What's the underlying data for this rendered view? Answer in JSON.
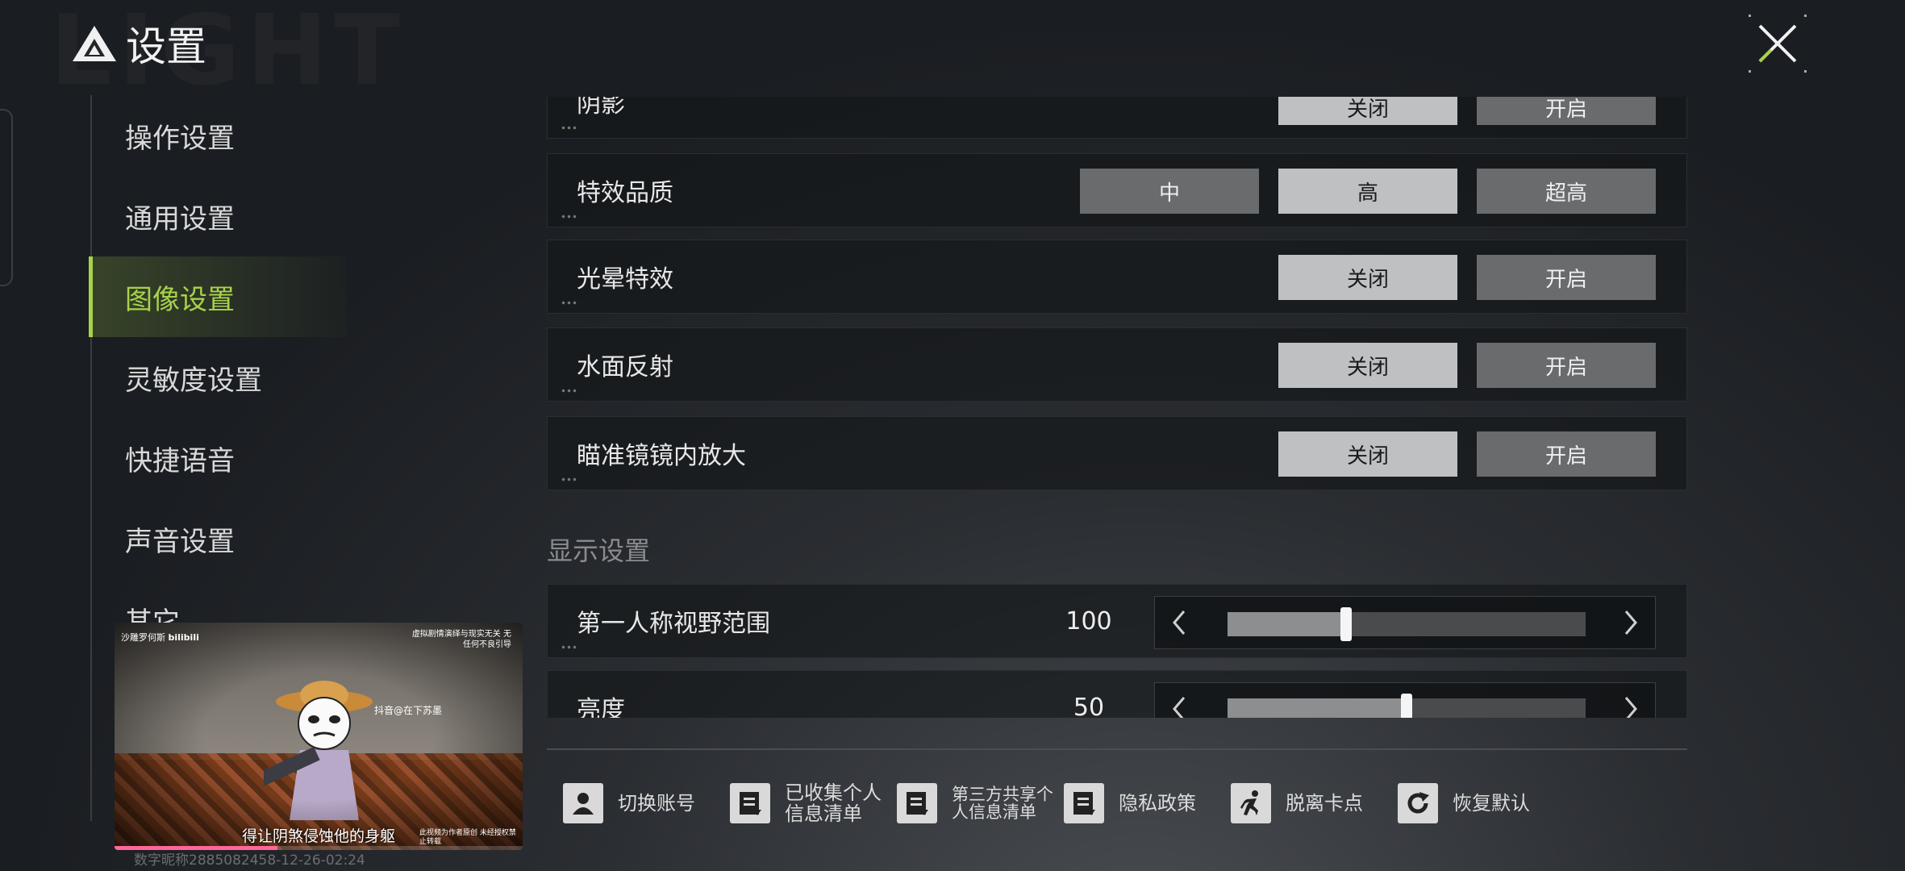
{
  "header": {
    "title": "设置",
    "watermark": "LIGHT"
  },
  "sidebar": {
    "items": [
      {
        "label": "操作设置"
      },
      {
        "label": "通用设置"
      },
      {
        "label": "图像设置"
      },
      {
        "label": "灵敏度设置"
      },
      {
        "label": "快捷语音"
      },
      {
        "label": "声音设置"
      },
      {
        "label": "其它"
      }
    ],
    "active_index": 2
  },
  "image_settings": {
    "shadow": {
      "label": "阴影",
      "options": [
        "关闭",
        "开启"
      ],
      "selected": "关闭"
    },
    "effects_quality": {
      "label": "特效品质",
      "options": [
        "中",
        "高",
        "超高"
      ],
      "selected": "高"
    },
    "bloom": {
      "label": "光晕特效",
      "options": [
        "关闭",
        "开启"
      ],
      "selected": "关闭"
    },
    "water_reflection": {
      "label": "水面反射",
      "options": [
        "关闭",
        "开启"
      ],
      "selected": "关闭"
    },
    "scope_zoom": {
      "label": "瞄准镜镜内放大",
      "options": [
        "关闭",
        "开启"
      ],
      "selected": "关闭"
    }
  },
  "display_settings": {
    "section_title": "显示设置",
    "fov": {
      "label": "第一人称视野范围",
      "value": "100",
      "fill_fraction": 0.33
    },
    "brightness": {
      "label": "亮度",
      "value": "50",
      "fill_fraction": 0.5
    }
  },
  "bottom_bar": {
    "switch_account": "切换账号",
    "collected_info_1": "已收集个人",
    "collected_info_2": "信息清单",
    "third_party_1": "第三方共享个",
    "third_party_2": "人信息清单",
    "privacy_policy": "隐私政策",
    "unstuck": "脱离卡点",
    "restore_default": "恢复默认"
  },
  "video": {
    "uploader": "沙雕罗何斯",
    "platform": "bilibili",
    "disclaimer": "虚拟剧情演绎与现实无关 无任何不良引导",
    "caption_mid": "抖音@在下苏墨",
    "subtitle": "得让阴煞侵蚀他的身躯",
    "watermark_br": "此视频为作者原创 未经授权禁止转载",
    "progress_fraction": 0.4
  },
  "footer": {
    "user_id": "数字昵称2885082458-12-26-02:24"
  },
  "colors": {
    "accent": "#a8d24a",
    "selected_btn": "#bfc0c1",
    "unselected_btn": "#6a6b6d"
  }
}
